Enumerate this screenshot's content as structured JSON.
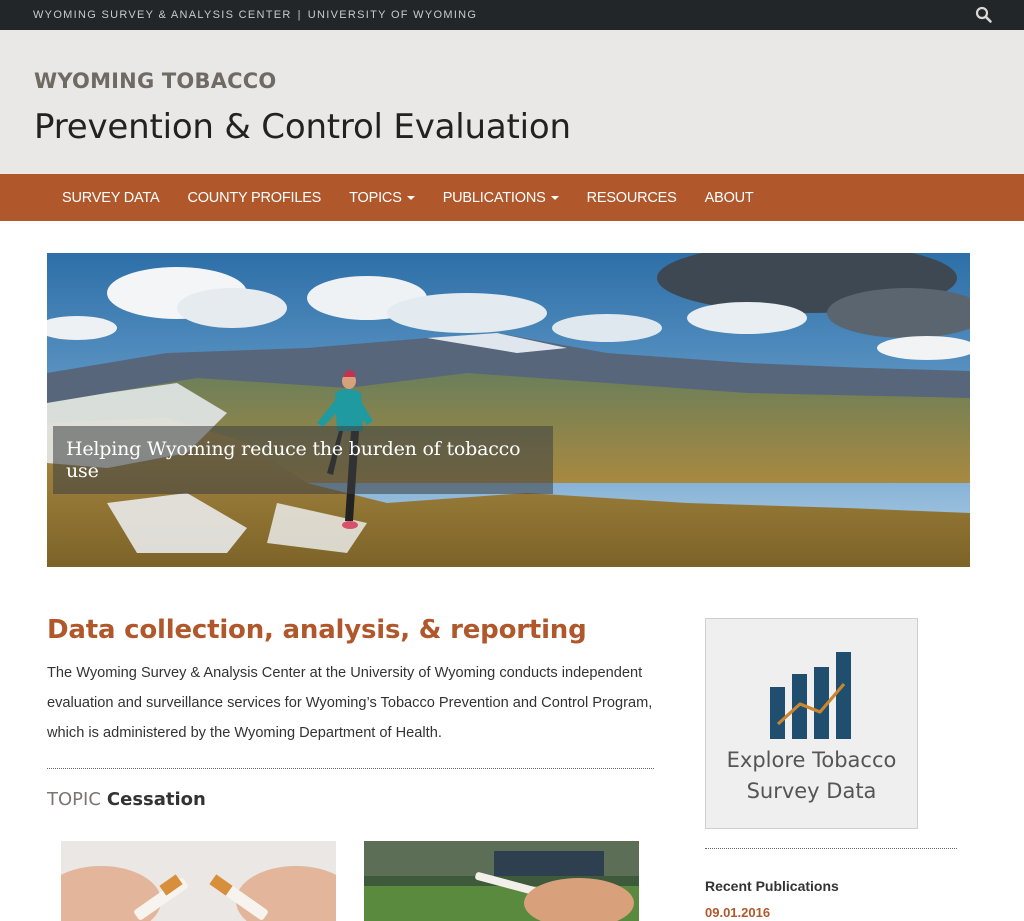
{
  "topbar": {
    "org": "WYOMING SURVEY & ANALYSIS CENTER",
    "separator": "|",
    "university": "UNIVERSITY OF WYOMING",
    "search_icon": "search-icon"
  },
  "header": {
    "kicker": "WYOMING TOBACCO",
    "title": "Prevention & Control Evaluation"
  },
  "nav": {
    "items": [
      {
        "label": "SURVEY DATA",
        "dropdown": false
      },
      {
        "label": "COUNTY PROFILES",
        "dropdown": false
      },
      {
        "label": "TOPICS",
        "dropdown": true
      },
      {
        "label": "PUBLICATIONS",
        "dropdown": true
      },
      {
        "label": "RESOURCES",
        "dropdown": false
      },
      {
        "label": "ABOUT",
        "dropdown": false
      }
    ]
  },
  "hero": {
    "caption": "Helping Wyoming reduce the burden of tobacco use"
  },
  "main": {
    "heading": "Data collection, analysis, & reporting",
    "body": "The Wyoming Survey & Analysis Center at the University of Wyoming conducts independent evaluation and surveillance services for Wyoming’s Tobacco Prevention and Control Program, which is administered by the Wyoming Department of Health.",
    "topic_label": "TOPIC",
    "topic_name": "Cessation"
  },
  "sidebar": {
    "explore_label": "Explore Tobacco Survey Data",
    "explore_icon": "bar-chart-icon",
    "recent_heading": "Recent Publications",
    "recent_date": "09.01.2016"
  },
  "colors": {
    "accent": "#b0582b",
    "topbar": "#222629",
    "header_bg": "#e9e8e6",
    "chart_bars": "#1f4e6e",
    "chart_line": "#c9862f"
  }
}
